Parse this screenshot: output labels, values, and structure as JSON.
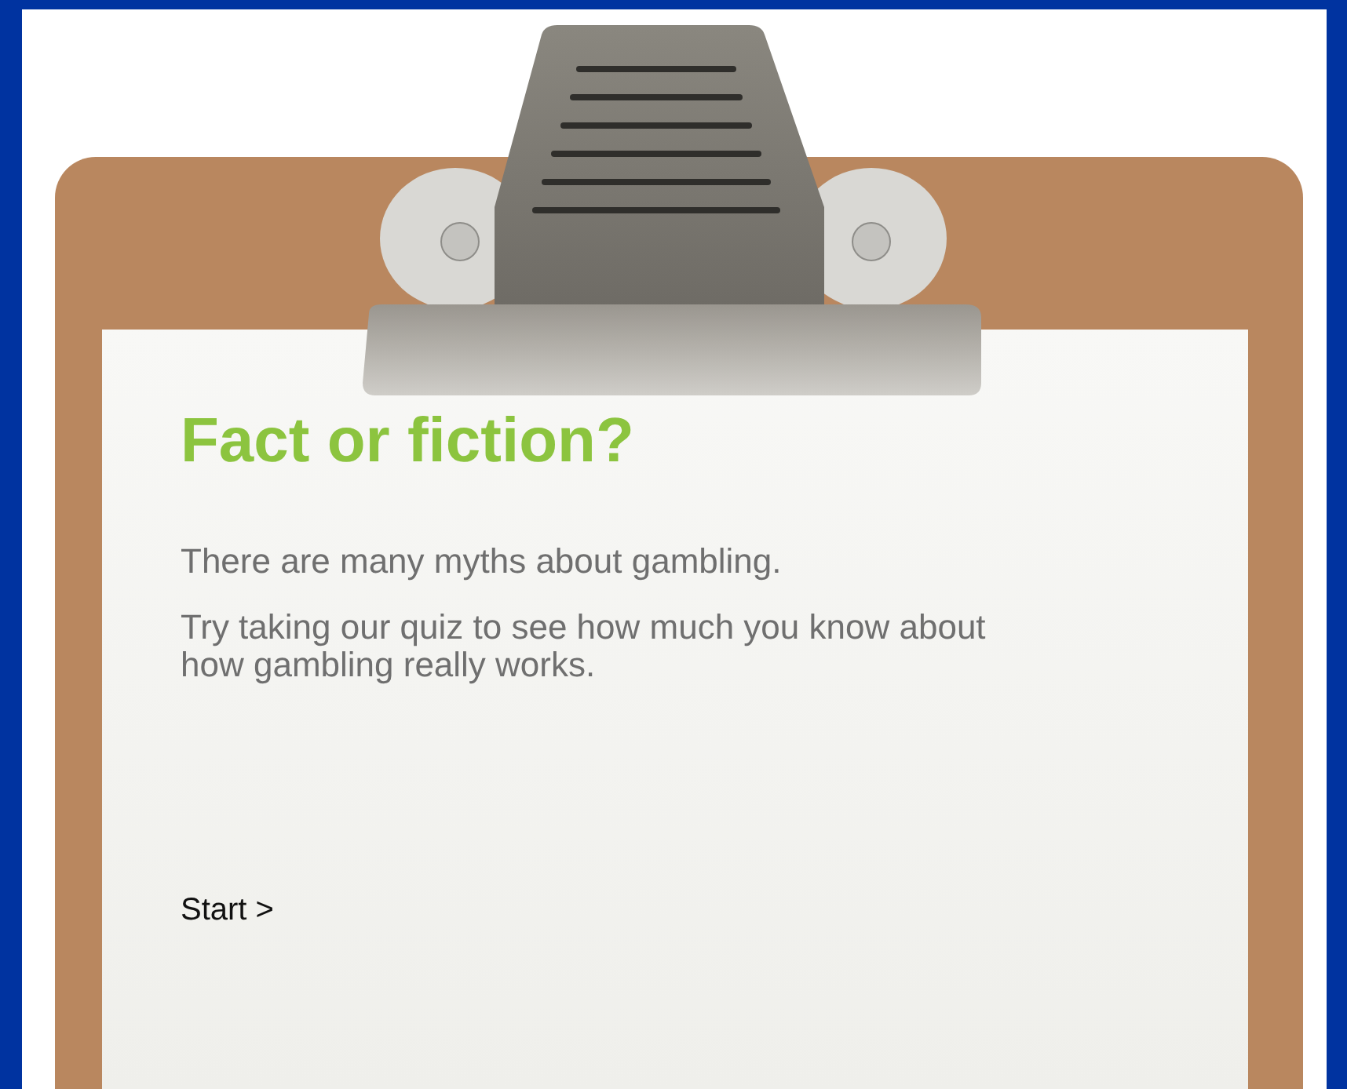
{
  "quiz": {
    "title": "Fact or fiction?",
    "paragraphs": [
      "There are many myths about gambling.",
      "Try taking our quiz to see how much you know about how gambling really works."
    ],
    "start_link": "Start >"
  }
}
